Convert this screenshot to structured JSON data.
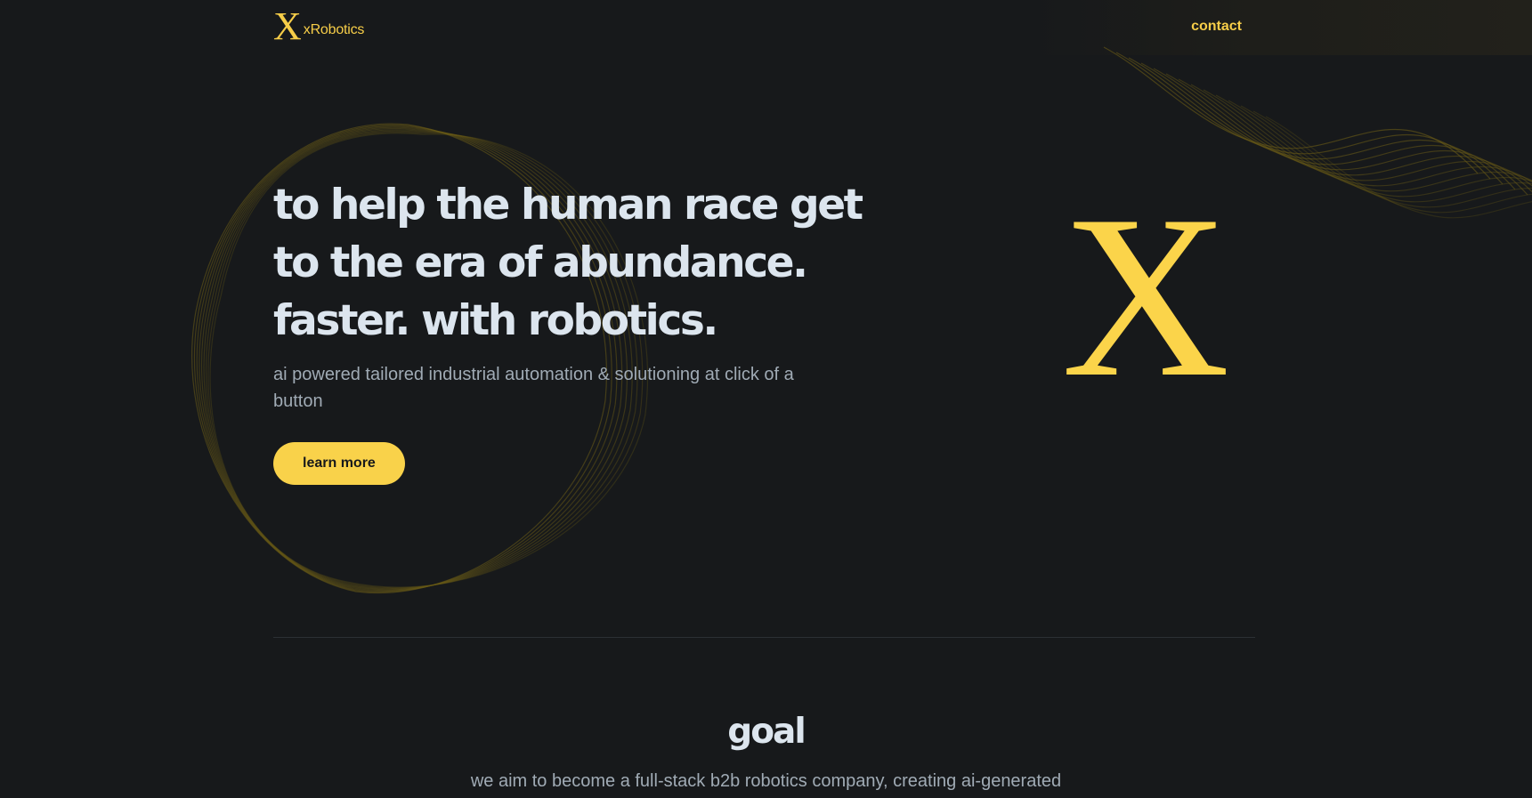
{
  "colors": {
    "background": "#17191b",
    "accent": "#f9d24a",
    "heading": "#dce5ee",
    "muted": "#a0abb5"
  },
  "header": {
    "logo_mark": "X",
    "logo_text": "xRobotics",
    "nav_contact": "contact"
  },
  "hero": {
    "title_lines": [
      "to help the human race get",
      "to the era of abundance.",
      "faster. with robotics."
    ],
    "subtitle": "ai powered tailored industrial automation & solutioning at click of a button",
    "cta_label": "learn more",
    "brand_mark": "X"
  },
  "goal": {
    "title": "goal",
    "text": "we aim to become a full-stack b2b robotics company, creating ai-generated"
  },
  "icons": {
    "logo": "x-serif-logo-icon"
  }
}
